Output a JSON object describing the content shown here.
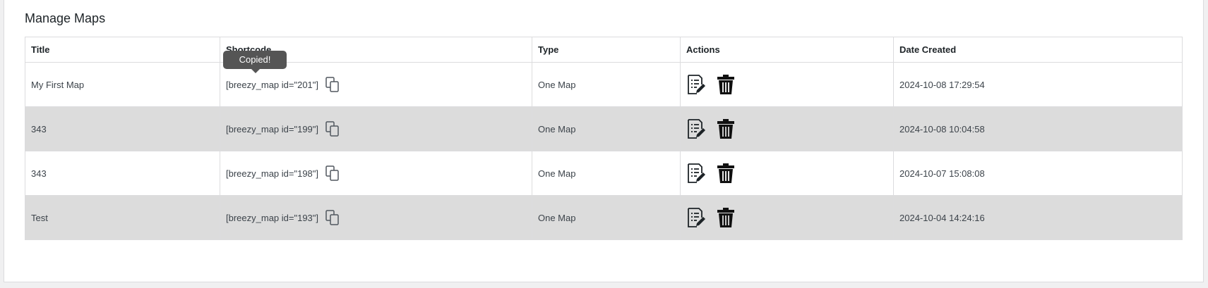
{
  "page": {
    "title": "Manage Maps"
  },
  "table": {
    "headers": {
      "title": "Title",
      "shortcode": "Shortcode",
      "type": "Type",
      "actions": "Actions",
      "date": "Date Created"
    },
    "rows": [
      {
        "title": "My First Map",
        "shortcode": "[breezy_map id=\"201\"]",
        "type": "One Map",
        "date": "2024-10-08 17:29:54"
      },
      {
        "title": "343",
        "shortcode": "[breezy_map id=\"199\"]",
        "type": "One Map",
        "date": "2024-10-08 10:04:58"
      },
      {
        "title": "343",
        "shortcode": "[breezy_map id=\"198\"]",
        "type": "One Map",
        "date": "2024-10-07 15:08:08"
      },
      {
        "title": "Test",
        "shortcode": "[breezy_map id=\"193\"]",
        "type": "One Map",
        "date": "2024-10-04 14:24:16"
      }
    ]
  },
  "tooltip": {
    "text": "Copied!"
  },
  "icons": {
    "copy": "copy-icon",
    "edit": "edit-icon",
    "delete": "trash-icon"
  },
  "colors": {
    "alt_row": "#dcdcdc",
    "tooltip_bg": "#555555",
    "border": "#dcdcde"
  }
}
